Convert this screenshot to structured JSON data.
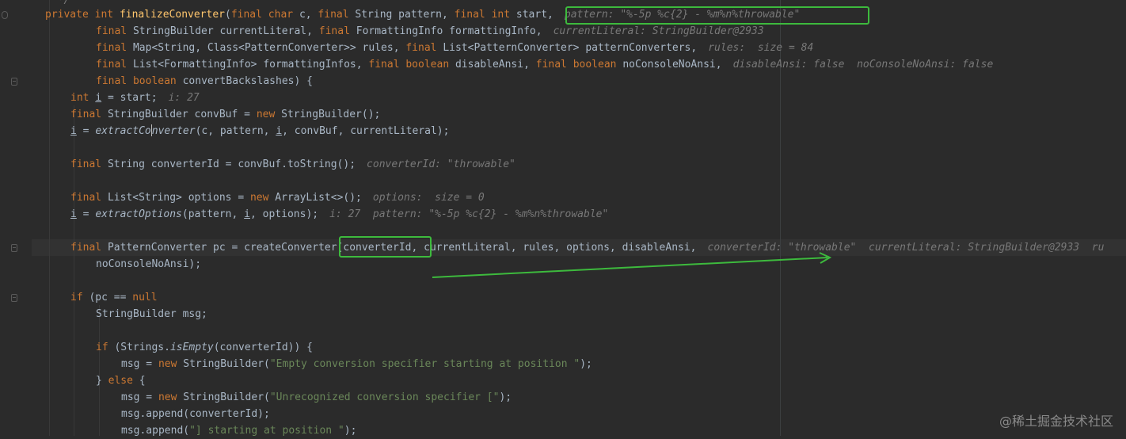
{
  "lines": [
    {
      "text": "  */"
    },
    {
      "tokens": [
        [
          "kw",
          "private "
        ],
        [
          "kw",
          "int "
        ],
        [
          "fn",
          "finalizeConverter"
        ],
        [
          "",
          "("
        ],
        [
          "kw",
          "final "
        ],
        [
          "kw",
          "char "
        ],
        [
          "",
          "c, "
        ],
        [
          "kw",
          "final "
        ],
        [
          "",
          "String pattern, "
        ],
        [
          "kw",
          "final "
        ],
        [
          "kw",
          "int "
        ],
        [
          "",
          "start,"
        ]
      ],
      "hint": "pattern: \"%-5p %c{2} - %m%n%throwable\""
    },
    {
      "tokens": [
        [
          "kw",
          "final "
        ],
        [
          "",
          "StringBuilder currentLiteral, "
        ],
        [
          "kw",
          "final "
        ],
        [
          "",
          "FormattingInfo formattingInfo,"
        ]
      ],
      "hint": "currentLiteral: StringBuilder@2933"
    },
    {
      "tokens": [
        [
          "kw",
          "final "
        ],
        [
          "",
          "Map<String, Class<PatternConverter>> rules, "
        ],
        [
          "kw",
          "final "
        ],
        [
          "",
          "List<PatternConverter> patternConverters,"
        ]
      ],
      "hint": "rules:  size = 84"
    },
    {
      "tokens": [
        [
          "kw",
          "final "
        ],
        [
          "",
          "List<FormattingInfo> formattingInfos, "
        ],
        [
          "kw",
          "final "
        ],
        [
          "kw",
          "boolean "
        ],
        [
          "",
          "disableAnsi, "
        ],
        [
          "kw",
          "final "
        ],
        [
          "kw",
          "boolean "
        ],
        [
          "",
          "noConsoleNoAnsi,"
        ]
      ],
      "hint": "disableAnsi: false  noConsoleNoAnsi: false"
    },
    {
      "tokens": [
        [
          "kw",
          "final "
        ],
        [
          "kw",
          "boolean "
        ],
        [
          "",
          "convertBackslashes) {"
        ]
      ]
    },
    {
      "tokens": [
        [
          "kw",
          "int "
        ],
        [
          "ul",
          "i"
        ],
        [
          "",
          " = start;"
        ]
      ],
      "hint": "i: 27"
    },
    {
      "tokens": [
        [
          "kw",
          "final "
        ],
        [
          "",
          "StringBuilder convBuf = "
        ],
        [
          "kw",
          "new "
        ],
        [
          "",
          "StringBuilder();"
        ]
      ]
    },
    {
      "tokens": [
        [
          "ul",
          "i"
        ],
        [
          "",
          " = "
        ],
        [
          "it",
          "extractCo"
        ],
        [
          "caret",
          ""
        ],
        [
          "it",
          "nverter"
        ],
        [
          "",
          "(c, pattern, "
        ],
        [
          "ul",
          "i"
        ],
        [
          "",
          ", convBuf, currentLiteral);"
        ]
      ]
    },
    {
      "tokens": []
    },
    {
      "tokens": [
        [
          "kw",
          "final "
        ],
        [
          "",
          "String converterId = convBuf.toString();"
        ]
      ],
      "hint": "converterId: \"throwable\""
    },
    {
      "tokens": []
    },
    {
      "tokens": [
        [
          "kw",
          "final "
        ],
        [
          "",
          "List<String> options = "
        ],
        [
          "kw",
          "new "
        ],
        [
          "",
          "ArrayList<>();"
        ]
      ],
      "hint": "options:  size = 0"
    },
    {
      "tokens": [
        [
          "ul",
          "i"
        ],
        [
          "",
          " = "
        ],
        [
          "it",
          "extractOptions"
        ],
        [
          "",
          "(pattern, "
        ],
        [
          "ul",
          "i"
        ],
        [
          "",
          ", options);"
        ]
      ],
      "hint": "i: 27  pattern: \"%-5p %c{2} - %m%n%throwable\""
    },
    {
      "tokens": []
    },
    {
      "tokens": [
        [
          "kw",
          "final "
        ],
        [
          "",
          "PatternConverter pc = createConverter(converterId, currentLiteral, rules, options, disableAnsi,"
        ]
      ],
      "hint": "converterId: \"throwable\"  currentLiteral: StringBuilder@2933  ru"
    },
    {
      "tokens": [
        [
          "",
          "noConsoleNoAnsi);"
        ]
      ]
    },
    {
      "tokens": []
    },
    {
      "tokens": [
        [
          "kw",
          "if "
        ],
        [
          "",
          "(pc == "
        ],
        [
          "kw",
          "null"
        ],
        [
          ") {"
        ]
      ]
    },
    {
      "tokens": [
        [
          "",
          "StringBuilder msg;"
        ]
      ]
    },
    {
      "tokens": []
    },
    {
      "tokens": [
        [
          "kw",
          "if "
        ],
        [
          "",
          "(Strings."
        ],
        [
          "it",
          "isEmpty"
        ],
        [
          "",
          "(converterId)) {"
        ]
      ]
    },
    {
      "tokens": [
        [
          "",
          "msg = "
        ],
        [
          "kw",
          "new "
        ],
        [
          "",
          "StringBuilder("
        ],
        [
          "st",
          "\"Empty conversion specifier starting at position \""
        ],
        [
          "",
          ");"
        ]
      ]
    },
    {
      "tokens": [
        [
          "",
          "} "
        ],
        [
          "kw",
          "else "
        ],
        [
          "",
          "{"
        ]
      ]
    },
    {
      "tokens": [
        [
          "",
          "msg = "
        ],
        [
          "kw",
          "new "
        ],
        [
          "",
          "StringBuilder("
        ],
        [
          "st",
          "\"Unrecognized conversion specifier [\""
        ],
        [
          "",
          ");"
        ]
      ]
    },
    {
      "tokens": [
        [
          "",
          "msg.append(converterId);"
        ]
      ]
    },
    {
      "tokens": [
        [
          "",
          "msg.append("
        ],
        [
          "st",
          "\"] starting at position \""
        ],
        [
          "",
          ");"
        ]
      ]
    }
  ],
  "watermark": "@稀土掘金技术社区"
}
